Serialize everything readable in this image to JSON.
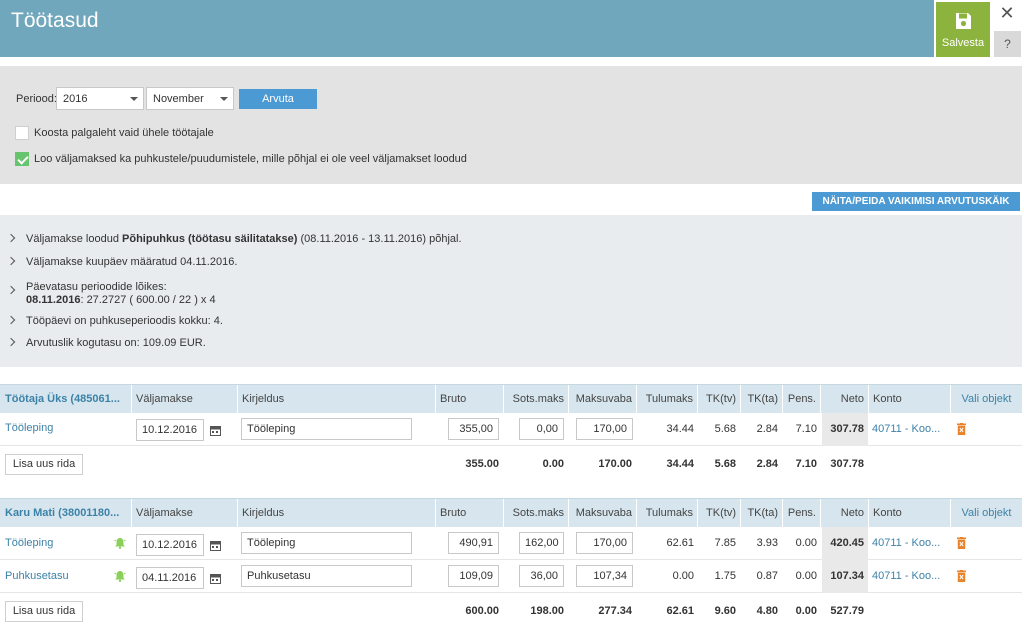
{
  "header": {
    "title": "Töötasud",
    "save_label": "Salvesta",
    "close_label": "✕",
    "help_label": "?"
  },
  "filters": {
    "period_label": "Periood:",
    "year": "2016",
    "month": "November",
    "calc_label": "Arvuta",
    "opt_single": "Koosta palgaleht vaid ühele töötajale",
    "opt_single_checked": false,
    "opt_payouts": "Loo väljamaksed ka puhkustele/puudumistele, mille põhjal ei ole veel väljamakset loodud",
    "opt_payouts_checked": true
  },
  "toggle_label": "NÄITA/PEIDA VAIKIMISI ARVUTUSKÄIK",
  "info": {
    "line1_pre": "Väljamakse loodud ",
    "line1_bold": "Põhipuhkus (töötasu säilitatakse)",
    "line1_post": " (08.11.2016 - 13.11.2016) põhjal.",
    "line2": "Väljamakse kuupäev määratud 04.11.2016.",
    "line3a": "Päevatasu perioodide lõikes:",
    "line3b_bold": "08.11.2016",
    "line3b_rest": ": 27.2727 ( 600.00 / 22 ) x 4",
    "line4": "Tööpäevi on puhkuseperioodis kokku: 4.",
    "line5": "Arvutuslik kogutasu on: 109.09 EUR."
  },
  "columns": {
    "payout": "Väljamakse",
    "desc": "Kirjeldus",
    "bruto": "Bruto",
    "sots": "Sots.maks",
    "maksuvaba": "Maksuvaba",
    "tulumaks": "Tulumaks",
    "tktv": "TK(tv)",
    "tkta": "TK(ta)",
    "pens": "Pens.",
    "neto": "Neto",
    "konto": "Konto",
    "object": "Vali objekt"
  },
  "add_row_label": "Lisa uus rida",
  "emp1": {
    "name": "Töötaja Üks (485061...",
    "rows": [
      {
        "type": "Tööleping",
        "date": "10.12.2016",
        "desc": "Tööleping",
        "bruto": "355,00",
        "sots": "0,00",
        "maksuvaba": "170,00",
        "tulumaks": "34.44",
        "tktv": "5.68",
        "tkta": "2.84",
        "pens": "7.10",
        "neto": "307.78",
        "konto": "40711 - Koo..."
      }
    ],
    "totals": {
      "bruto": "355.00",
      "sots": "0.00",
      "maksuvaba": "170.00",
      "tulumaks": "34.44",
      "tktv": "5.68",
      "tkta": "2.84",
      "pens": "7.10",
      "neto": "307.78"
    }
  },
  "emp2": {
    "name": "Karu Mati (38001180...",
    "rows": [
      {
        "type": "Tööleping",
        "date": "10.12.2016",
        "desc": "Tööleping",
        "bruto": "490,91",
        "sots": "162,00",
        "maksuvaba": "170,00",
        "tulumaks": "62.61",
        "tktv": "7.85",
        "tkta": "3.93",
        "pens": "0.00",
        "neto": "420.45",
        "konto": "40711 - Koo..."
      },
      {
        "type": "Puhkusetasu",
        "date": "04.11.2016",
        "desc": "Puhkusetasu",
        "bruto": "109,09",
        "sots": "36,00",
        "maksuvaba": "107,34",
        "tulumaks": "0.00",
        "tktv": "1.75",
        "tkta": "0.87",
        "pens": "0.00",
        "neto": "107.34",
        "konto": "40711 - Koo..."
      }
    ],
    "totals": {
      "bruto": "600.00",
      "sots": "198.00",
      "maksuvaba": "277.34",
      "tulumaks": "62.61",
      "tktv": "9.60",
      "tkta": "4.80",
      "pens": "0.00",
      "neto": "527.79"
    }
  },
  "colors": {
    "header": "#71a7bd",
    "save": "#8db33f",
    "accent": "#4c9ad3",
    "link": "#3c82a8",
    "delete": "#e8832a",
    "bell": "#8ccf5a"
  }
}
